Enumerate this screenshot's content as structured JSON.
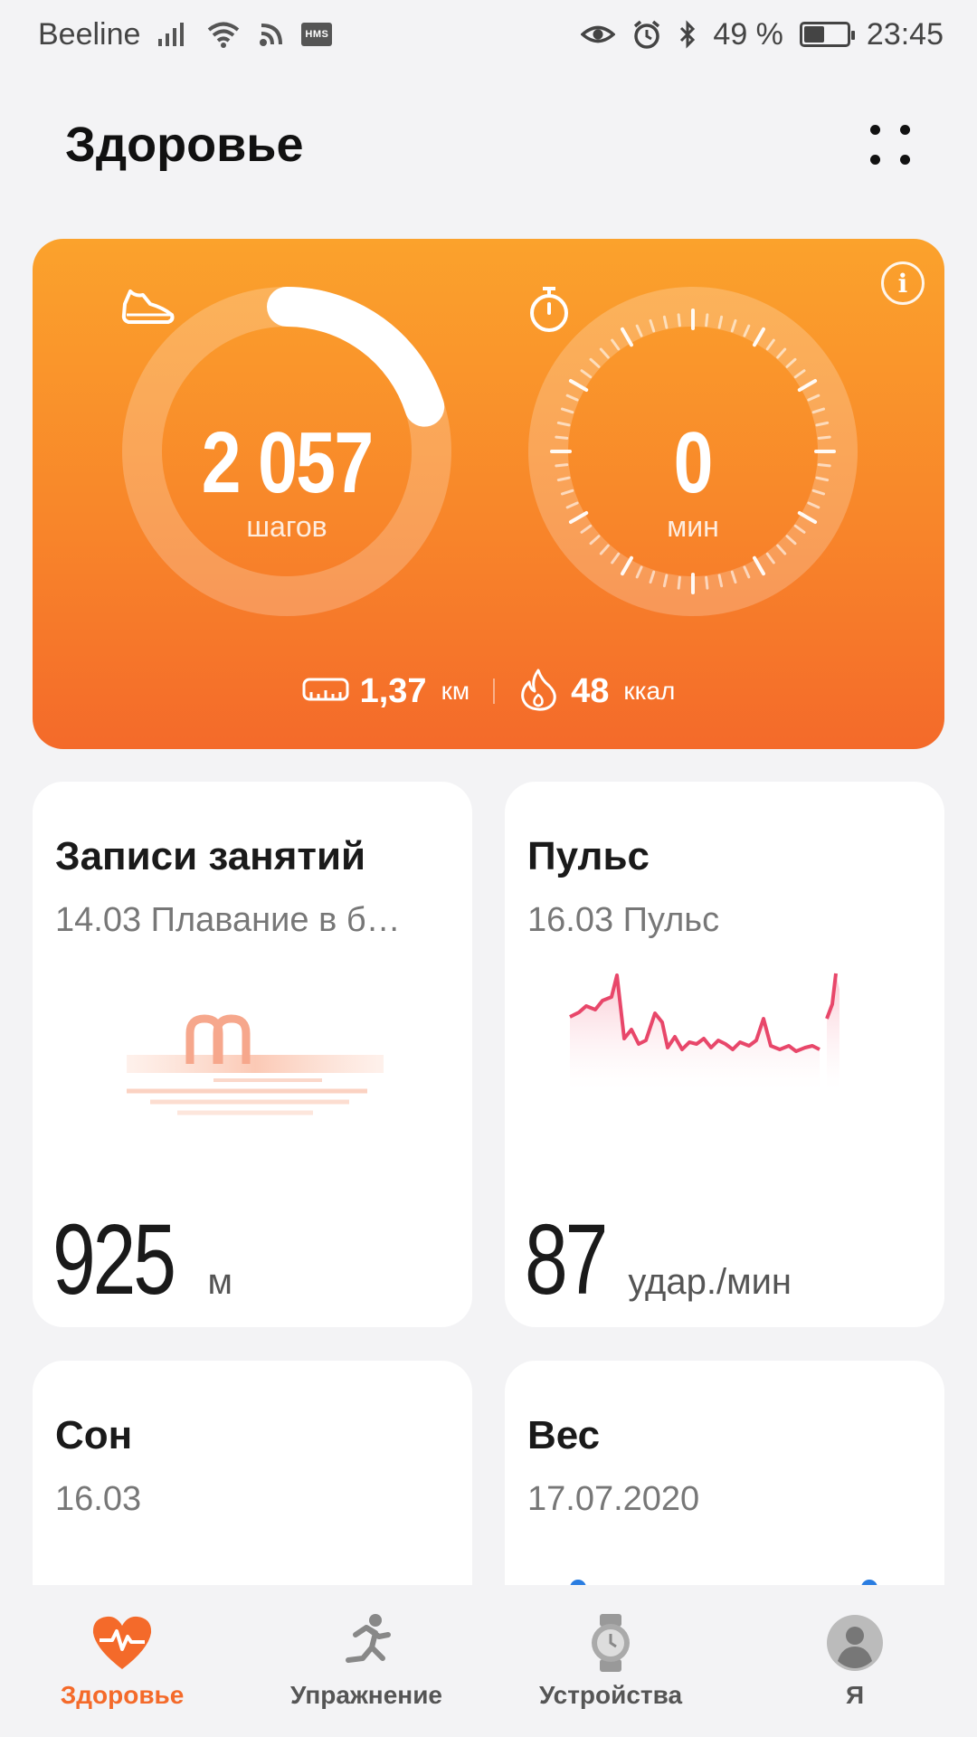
{
  "status_bar": {
    "carrier": "Beeline",
    "hms_badge": "HMS",
    "battery_percent": "49 %",
    "battery_level": 0.49,
    "time": "23:45"
  },
  "header": {
    "title": "Здоровье"
  },
  "activity": {
    "steps_value": "2 057",
    "steps_unit": "шагов",
    "steps_goal_progress": 0.2,
    "minutes_value": "0",
    "minutes_unit": "мин",
    "distance_value": "1,37",
    "distance_unit": "км",
    "calories_value": "48",
    "calories_unit": "ккал",
    "accent_color": "#f8862a"
  },
  "cards": {
    "workouts": {
      "title": "Записи занятий",
      "subtitle": "14.03 Плавание в б…",
      "value": "925",
      "unit": "м"
    },
    "pulse": {
      "title": "Пульс",
      "subtitle": "16.03 Пульс",
      "value": "87",
      "unit": "удар./мин",
      "line_color": "#e8476a"
    },
    "sleep": {
      "title": "Сон",
      "subtitle": "16.03"
    },
    "weight": {
      "title": "Вес",
      "subtitle": "17.07.2020"
    }
  },
  "bottom_nav": [
    {
      "label": "Здоровье",
      "icon": "heart-pulse-icon",
      "active": true
    },
    {
      "label": "Упражнение",
      "icon": "running-icon",
      "active": false
    },
    {
      "label": "Устройства",
      "icon": "watch-icon",
      "active": false
    },
    {
      "label": "Я",
      "icon": "profile-icon",
      "active": false
    }
  ]
}
